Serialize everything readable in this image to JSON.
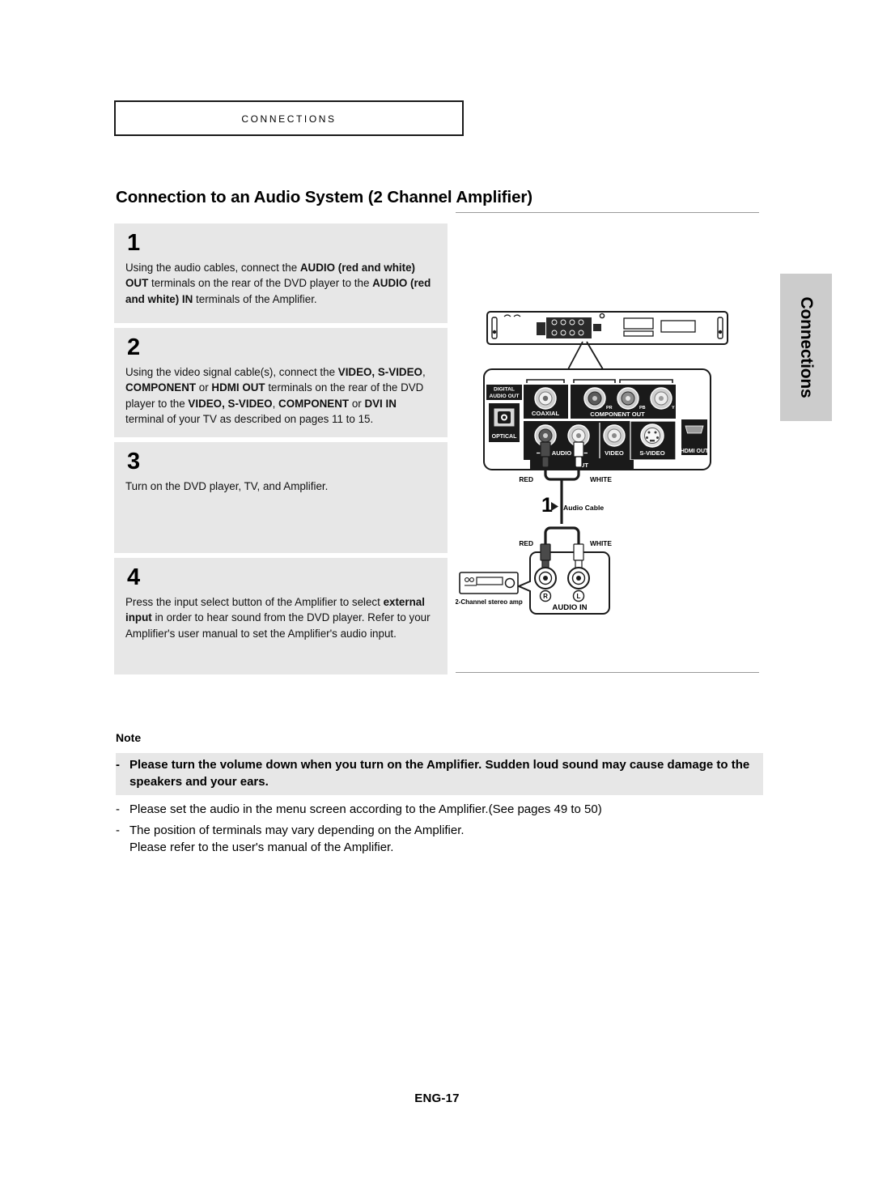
{
  "chapter": {
    "label": "CONNECTIONS"
  },
  "page_title": "Connection to an Audio System (2 Channel Amplifier)",
  "side_tab": {
    "label": "Connections",
    "color": "#cccccc"
  },
  "steps": [
    {
      "number": "1",
      "text_runs": [
        {
          "t": "Using the audio cables, connect the ",
          "b": false
        },
        {
          "t": "AUDIO (red and white)",
          "b": true
        },
        {
          "t": " ",
          "b": false
        },
        {
          "t": "OUT",
          "b": true
        },
        {
          "t": " terminals on the rear of the DVD player to the ",
          "b": false
        },
        {
          "t": "AUDIO (red and white) IN",
          "b": true
        },
        {
          "t": " terminals of the Amplifier.",
          "b": false
        }
      ]
    },
    {
      "number": "2",
      "text_runs": [
        {
          "t": "Using the video signal cable(s), connect the ",
          "b": false
        },
        {
          "t": "VIDEO, S-VIDEO",
          "b": true
        },
        {
          "t": ", ",
          "b": false
        },
        {
          "t": "COMPONENT",
          "b": true
        },
        {
          "t": " or ",
          "b": false
        },
        {
          "t": "HDMI OUT",
          "b": true
        },
        {
          "t": " terminals on the rear of the DVD player to the ",
          "b": false
        },
        {
          "t": "VIDEO, S-VIDEO",
          "b": true
        },
        {
          "t": ", ",
          "b": false
        },
        {
          "t": "COMPONENT",
          "b": true
        },
        {
          "t": " or ",
          "b": false
        },
        {
          "t": "DVI IN",
          "b": true
        },
        {
          "t": " terminal of your TV as described on pages 11 to 15.",
          "b": false
        }
      ]
    },
    {
      "number": "3",
      "text_runs": [
        {
          "t": "Turn on the DVD player, TV, and Amplifier.",
          "b": false
        }
      ]
    },
    {
      "number": "4",
      "text_runs": [
        {
          "t": "Press the input select button of the Amplifier to select ",
          "b": false
        },
        {
          "t": "external input",
          "b": true
        },
        {
          "t": "  in order to hear sound from the DVD player. Refer to your Amplifier's user manual to set the Amplifier's audio input.",
          "b": false
        }
      ]
    }
  ],
  "note": {
    "heading": "Note",
    "items": [
      {
        "dash": "-",
        "text": "Please turn the volume down when you turn on the Amplifier. Sudden loud sound may cause damage to the speakers and your ears.",
        "highlight": true
      },
      {
        "dash": "-",
        "text": "Please set the audio in the menu screen according to the Amplifier.(See pages 49 to 50)",
        "highlight": false
      },
      {
        "dash": "-",
        "text": "The position of terminals may vary depending on the Amplifier.\nPlease refer to the user's manual of the Amplifier.",
        "highlight": false
      }
    ]
  },
  "diagram": {
    "labels": {
      "digital_audio_out": "DIGITAL\nAUDIO OUT",
      "digital_audio_out_line1": "DIGITAL",
      "digital_audio_out_line2": "AUDIO OUT",
      "optical": "OPTICAL",
      "coaxial": "COAXIAL",
      "component_out": "COMPONENT OUT",
      "component_pr": "PR",
      "component_pb": "PB",
      "component_y": "Y",
      "audio": "AUDIO",
      "out": "OUT",
      "video": "VIDEO",
      "s_video": "S-VIDEO",
      "hdmi_out": "HDMI OUT",
      "red_top": "RED",
      "white_top": "WHITE",
      "step_marker": "1",
      "audio_cable": "Audio Cable",
      "red_bottom": "RED",
      "white_bottom": "WHITE",
      "jack_r": "R",
      "jack_l": "L",
      "audio_in": "AUDIO IN",
      "amp_caption": "2-Channel stereo amp"
    },
    "colors": {
      "panel_dark": "#1a1a1a",
      "red_plug": "#4a4a4a",
      "white_plug": "#ffffff",
      "rule": "#9a9a9a"
    }
  },
  "footer": {
    "page_label": "ENG-17"
  }
}
